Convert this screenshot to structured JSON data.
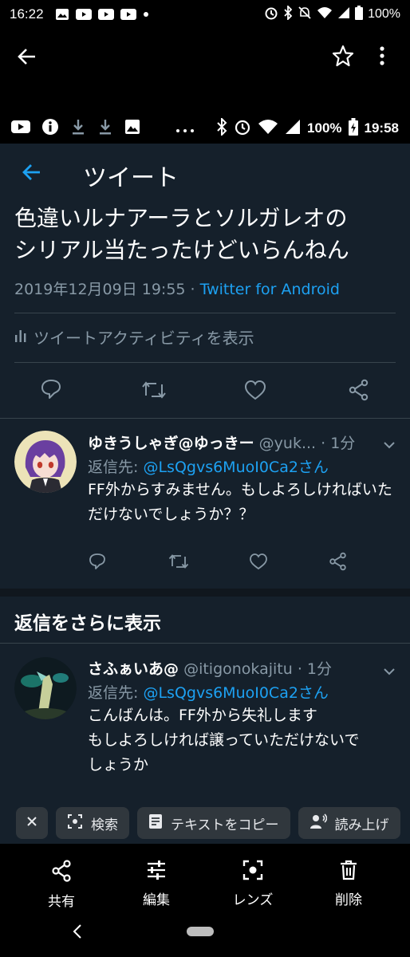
{
  "status_bar": {
    "time": "16:22",
    "battery": "100%"
  },
  "inner_status_bar": {
    "battery": "100%",
    "time": "19:58"
  },
  "header": {
    "title": "ツイート"
  },
  "tweet": {
    "text_line1": "色違いルナアーラとソルガレオの",
    "text_line2": "シリアル当たったけどいらんねん",
    "date": "2019年12月09日 19:55 · ",
    "via": "Twitter for Android",
    "activity": "ツイートアクティビティを表示"
  },
  "replies": [
    {
      "name": "ゆきうしゃぎ@ゆっきー",
      "handle": "@yuk...",
      "time": " · 1分",
      "reply_to_label": "返信先: ",
      "reply_to": "@LsQgvs6MuoI0Ca2さん",
      "body": "FF外からすみません。もしよろしければいただけないでしょうか？？"
    },
    {
      "name": "さふぁいあ@",
      "handle": "@itigonokajitu",
      "time": " · 1分",
      "reply_to_label": "返信先: ",
      "reply_to": "@LsQgvs6MuoI0Ca2さん",
      "body_line1": "こんばんは。FF外から失礼します",
      "body_line2": "もしよろしければ譲っていただけないで",
      "body_line3": "しょうか"
    }
  ],
  "more_replies": "返信をさらに表示",
  "chips": {
    "search": "検索",
    "copy_text": "テキストをコピー",
    "read_aloud": "読み上げ"
  },
  "toolbar": {
    "share": "共有",
    "edit": "編集",
    "lens": "レンズ",
    "delete": "削除"
  },
  "colors": {
    "background": "#15202b",
    "link": "#1da1f2",
    "muted": "#8899a6"
  }
}
